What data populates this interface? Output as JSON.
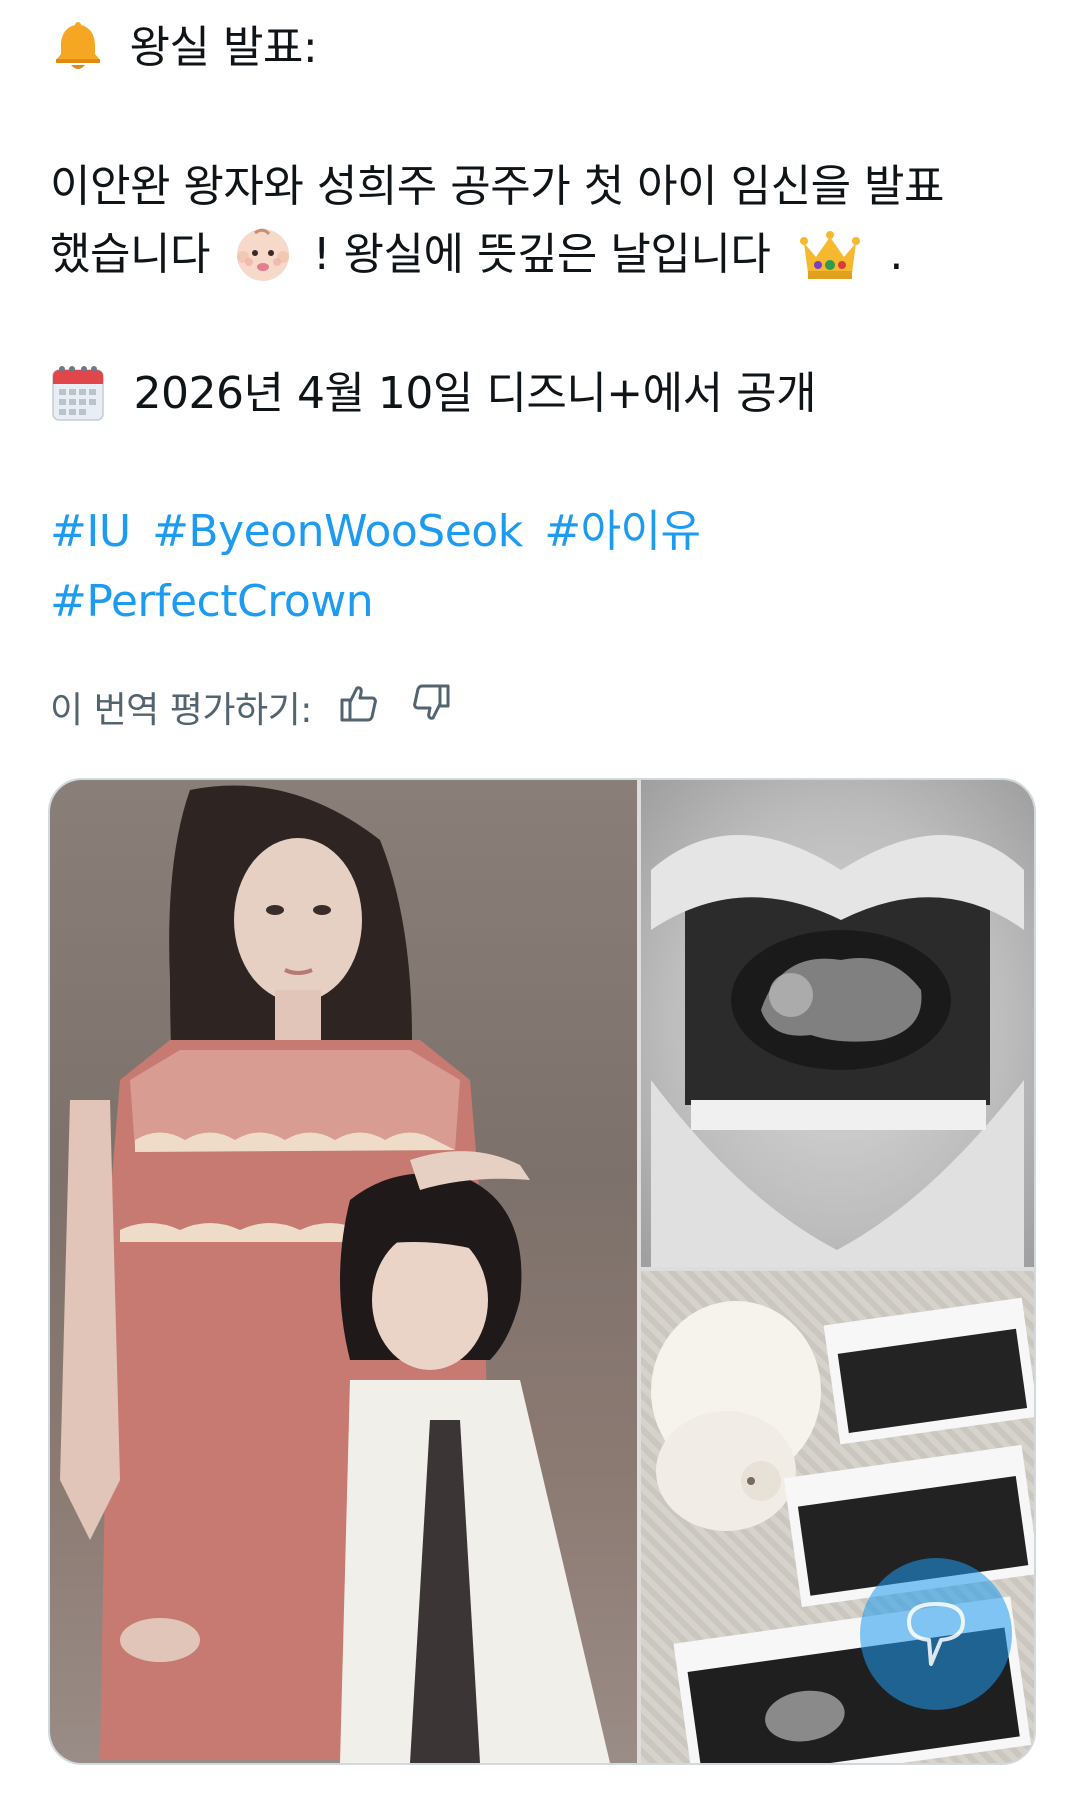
{
  "post": {
    "line1_text": "왕실 발표:",
    "line2_text": "이안완 왕자와 성희주 공주가 첫 아이 임신을 발표",
    "line3_part1": "했습니다",
    "line3_part2": "! 왕실에 뜻깊은 날입니다",
    "line3_part3": ".",
    "line4_text": "2026년 4월 10일 디즈니+에서 공개",
    "hashtags_line1": [
      "#IU",
      "#ByeonWooSeok",
      "#아이유"
    ],
    "hashtags_line2": [
      "#PerfectCrown"
    ]
  },
  "icons": {
    "bell": "bell-icon",
    "baby": "baby-icon",
    "crown": "crown-icon",
    "calendar": "calendar-icon",
    "thumbs_up": "thumbs-up-icon",
    "thumbs_down": "thumbs-down-icon",
    "chat_bubble": "chat-bubble-icon"
  },
  "translation_rating": {
    "label": "이 번역 평가하기:"
  },
  "colors": {
    "text": "#0f1419",
    "hashtag": "#1d9bf0",
    "secondary": "#536471",
    "fab": "#1d9bf0"
  }
}
